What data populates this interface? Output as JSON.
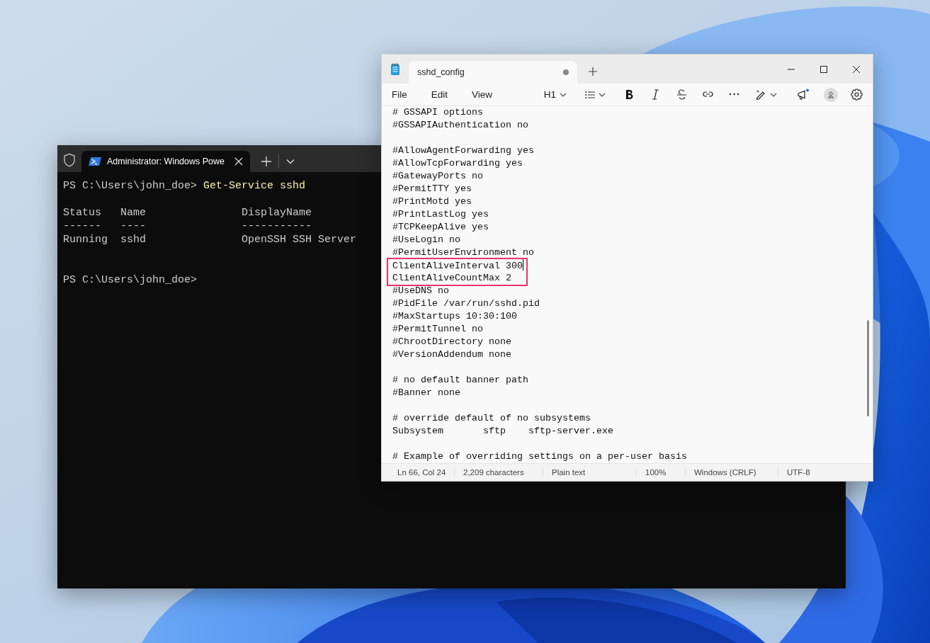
{
  "terminal": {
    "tab": {
      "title": "Administrator: Windows Powe",
      "selected": true
    },
    "session": [
      {
        "kind": "command",
        "prompt": "PS C:\\Users\\john_doe>",
        "command": "Get-Service sshd"
      },
      {
        "kind": "table",
        "columns": [
          "Status",
          "Name",
          "DisplayName"
        ],
        "rules": [
          "------",
          "----",
          "-----------"
        ],
        "rows": [
          [
            "Running",
            "sshd",
            "OpenSSH SSH Server"
          ]
        ]
      },
      {
        "kind": "command",
        "prompt": "PS C:\\Users\\john_doe>"
      }
    ]
  },
  "notepad": {
    "tab": {
      "title": "sshd_config",
      "unsaved": true
    },
    "menu": [
      "File",
      "Edit",
      "View"
    ],
    "heading_menu": "H1",
    "lines": [
      {
        "kind": "text",
        "text": "# GSSAPI options"
      },
      {
        "kind": "text",
        "text": "#GSSAPIAuthentication no"
      },
      {
        "kind": "blank"
      },
      {
        "kind": "text",
        "text": "#AllowAgentForwarding yes"
      },
      {
        "kind": "text",
        "text": "#AllowTcpForwarding yes"
      },
      {
        "kind": "text",
        "text": "#GatewayPorts no"
      },
      {
        "kind": "text",
        "text": "#PermitTTY yes"
      },
      {
        "kind": "text",
        "text": "#PrintMotd yes"
      },
      {
        "kind": "text",
        "text": "#PrintLastLog yes"
      },
      {
        "kind": "text",
        "text": "#TCPKeepAlive yes"
      },
      {
        "kind": "text",
        "text": "#UseLogin no"
      },
      {
        "kind": "text",
        "text": "#PermitUserEnvironment no"
      },
      {
        "kind": "text",
        "text": "ClientAliveInterval 300",
        "highlighted": true,
        "cursor": true
      },
      {
        "kind": "text",
        "text": "ClientAliveCountMax 2",
        "highlighted": true
      },
      {
        "kind": "text",
        "text": "#UseDNS no"
      },
      {
        "kind": "text",
        "text": "#PidFile /var/run/sshd.pid"
      },
      {
        "kind": "text",
        "text": "#MaxStartups 10:30:100"
      },
      {
        "kind": "text",
        "text": "#PermitTunnel no"
      },
      {
        "kind": "text",
        "text": "#ChrootDirectory none"
      },
      {
        "kind": "text",
        "text": "#VersionAddendum none"
      },
      {
        "kind": "blank"
      },
      {
        "kind": "text",
        "text": "# no default banner path"
      },
      {
        "kind": "text",
        "text": "#Banner none"
      },
      {
        "kind": "blank"
      },
      {
        "kind": "text",
        "text": "# override default of no subsystems"
      },
      {
        "kind": "text",
        "text": "Subsystem       sftp    sftp-server.exe"
      },
      {
        "kind": "blank"
      },
      {
        "kind": "text",
        "text": "# Example of overriding settings on a per-user basis"
      }
    ],
    "status_bar": [
      "Ln 66, Col 24",
      "2,209 characters",
      "Plain text",
      "100%",
      "Windows (CRLF)",
      "UTF-8"
    ]
  }
}
